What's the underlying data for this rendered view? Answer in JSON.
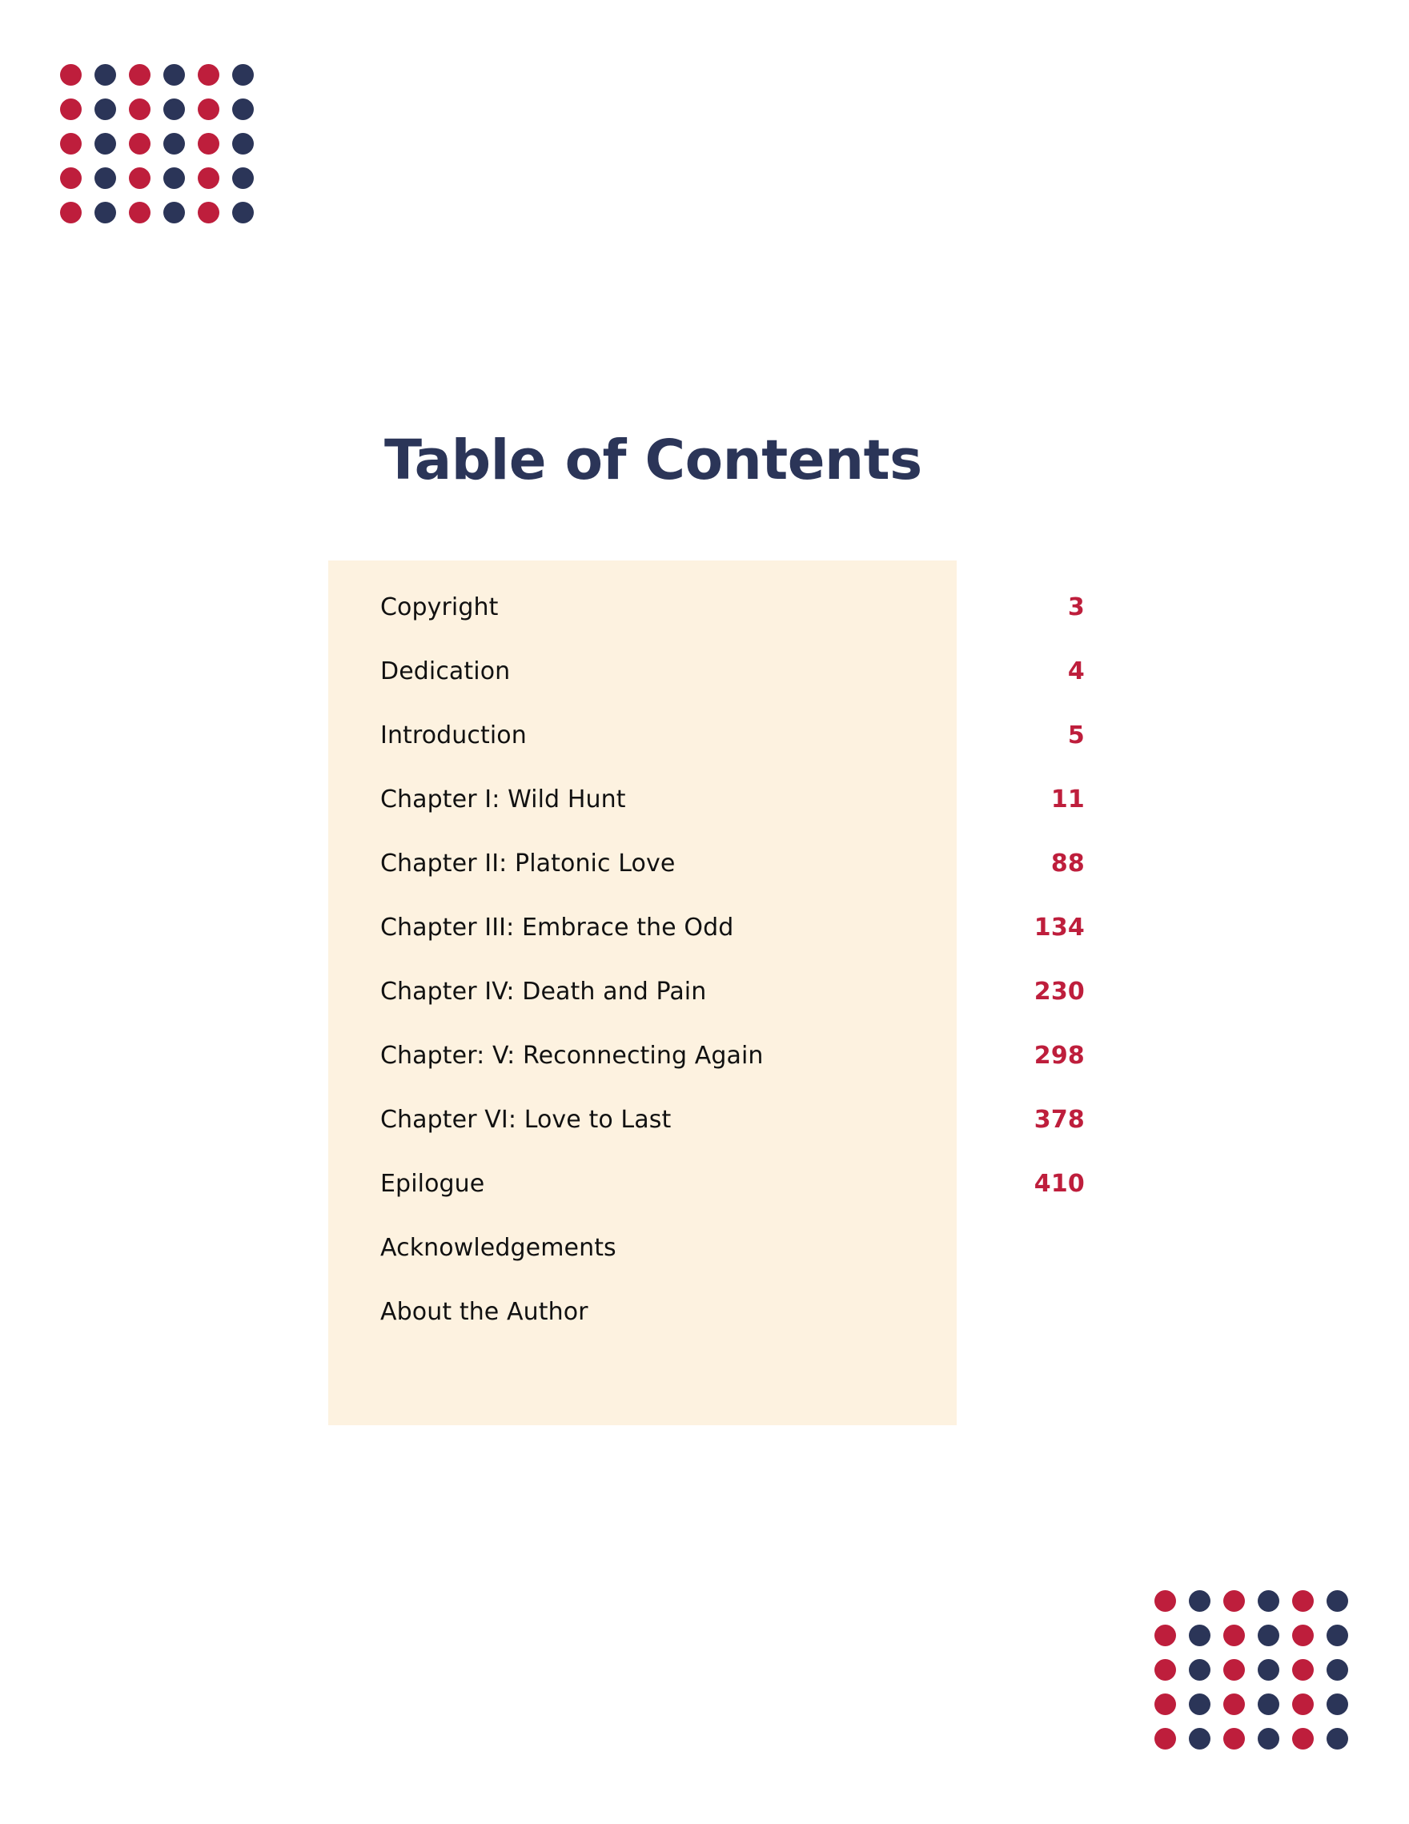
{
  "document": {
    "title": "Table of Contents",
    "page_background": "#FFFFFF"
  },
  "theme": {
    "accent_red": "#BE1E3C",
    "accent_navy": "#2B3558",
    "panel_cream": "#FDF2E0",
    "body_text": "#111111"
  },
  "decor": {
    "top_left_grid": {
      "name": "dot-grid-top-left",
      "columns": 6,
      "rows": 5,
      "column_colors": [
        "#BE1E3C",
        "#2B3558",
        "#BE1E3C",
        "#2B3558",
        "#BE1E3C",
        "#2B3558"
      ]
    },
    "bottom_right_grid": {
      "name": "dot-grid-bottom-right",
      "columns": 6,
      "rows": 5,
      "column_colors": [
        "#BE1E3C",
        "#2B3558",
        "#BE1E3C",
        "#2B3558",
        "#BE1E3C",
        "#2B3558"
      ]
    }
  },
  "toc": {
    "entries": [
      {
        "label": "Copyright",
        "page": "3"
      },
      {
        "label": "Dedication",
        "page": "4"
      },
      {
        "label": "Introduction",
        "page": "5"
      },
      {
        "label": "Chapter I: Wild Hunt",
        "page": "11"
      },
      {
        "label": "Chapter II: Platonic Love",
        "page": "88"
      },
      {
        "label": "Chapter III: Embrace the Odd",
        "page": "134"
      },
      {
        "label": "Chapter IV: Death and Pain",
        "page": "230"
      },
      {
        "label": "Chapter: V: Reconnecting Again",
        "page": "298"
      },
      {
        "label": "Chapter VI: Love to Last",
        "page": "378"
      },
      {
        "label": "Epilogue",
        "page": "410"
      },
      {
        "label": "Acknowledgements",
        "page": ""
      },
      {
        "label": "About the Author",
        "page": ""
      }
    ]
  }
}
